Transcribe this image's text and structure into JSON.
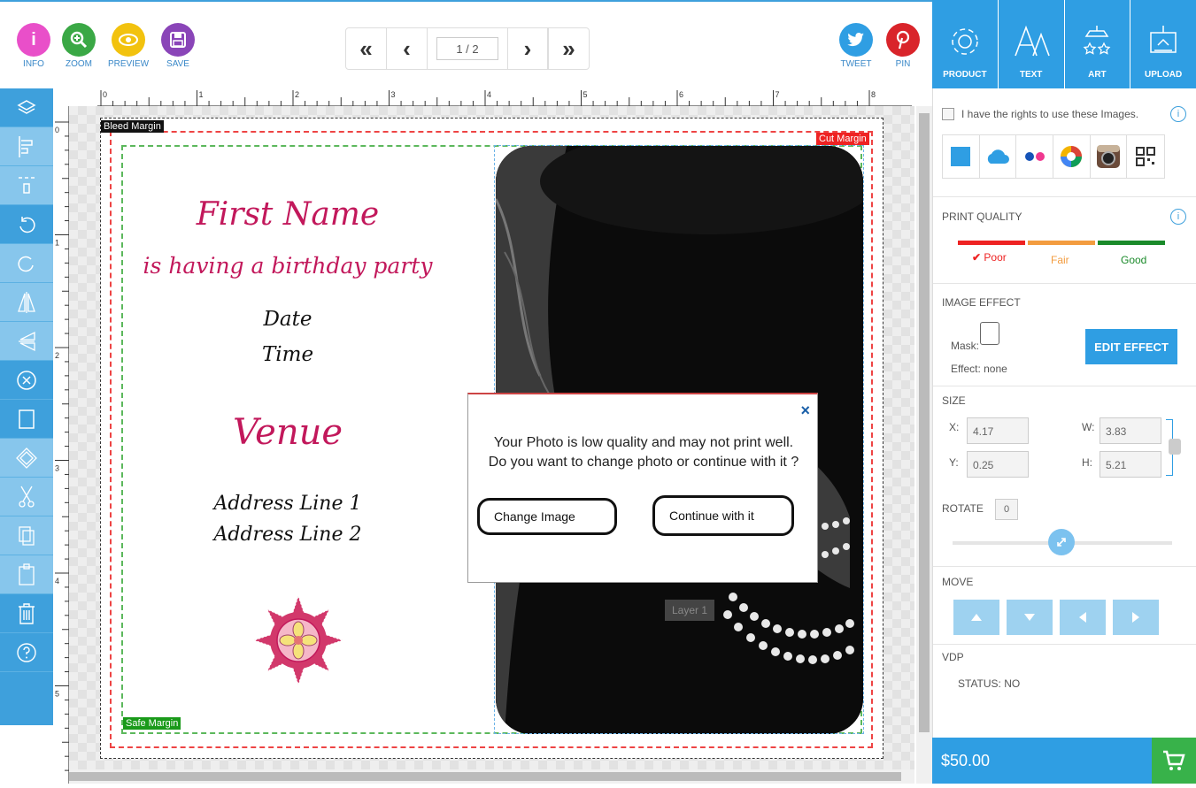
{
  "toolbar": {
    "info": {
      "label": "INFO",
      "color": "#e94fc9"
    },
    "zoom": {
      "label": "ZOOM",
      "color": "#3aa845"
    },
    "preview": {
      "label": "PREVIEW",
      "color": "#f2c20e"
    },
    "save": {
      "label": "SAVE",
      "color": "#8a45b8"
    },
    "tweet": {
      "label": "TWEET",
      "color": "#2f9ee3"
    },
    "pin": {
      "label": "PIN",
      "color": "#d9242a"
    }
  },
  "pager": {
    "first": "«",
    "prev": "‹",
    "page": "1 / 2",
    "next": "›",
    "last": "»"
  },
  "right_tabs": [
    "PRODUCT",
    "TEXT",
    "ART",
    "UPLOAD"
  ],
  "canvas": {
    "bleed_label": "Bleed Margin",
    "cut_label": "Cut Margin",
    "safe_label": "Safe Margin",
    "line1": "First Name",
    "line2": "is having a birthday party",
    "date": "Date",
    "time": "Time",
    "venue": "Venue",
    "addr1": "Address Line 1",
    "addr2": "Address Line 2",
    "layer": "Layer 1",
    "ruler_h": [
      "0",
      "1",
      "2",
      "3",
      "4",
      "5",
      "6",
      "7",
      "8"
    ],
    "ruler_v": [
      "0",
      "1",
      "2",
      "3",
      "4",
      "5"
    ]
  },
  "dialog": {
    "message_line1": "Your Photo is low quality and may not print well.",
    "message_line2": "Do you want to change photo or continue with it ?",
    "change_label": "Change Image",
    "continue_label": "Continue with it",
    "close": "×"
  },
  "panel": {
    "rights_label": "I have the rights to use these Images.",
    "info": "i",
    "print_quality": "PRINT QUALITY",
    "quality": {
      "poor": "Poor",
      "fair": "Fair",
      "good": "Good",
      "selected": "Poor"
    },
    "image_effect": "IMAGE EFFECT",
    "mask": "Mask:",
    "effect": "Effect: none",
    "edit_effect": "EDIT EFFECT",
    "size": "SIZE",
    "x_label": "X:",
    "x": "4.17",
    "y_label": "Y:",
    "y": "0.25",
    "w_label": "W:",
    "w": "3.83",
    "h_label": "H:",
    "h": "5.21",
    "rotate": "ROTATE",
    "rotate_value": "0",
    "move": "MOVE",
    "vdp": "VDP",
    "status": "STATUS: NO",
    "price": "$50.00"
  }
}
